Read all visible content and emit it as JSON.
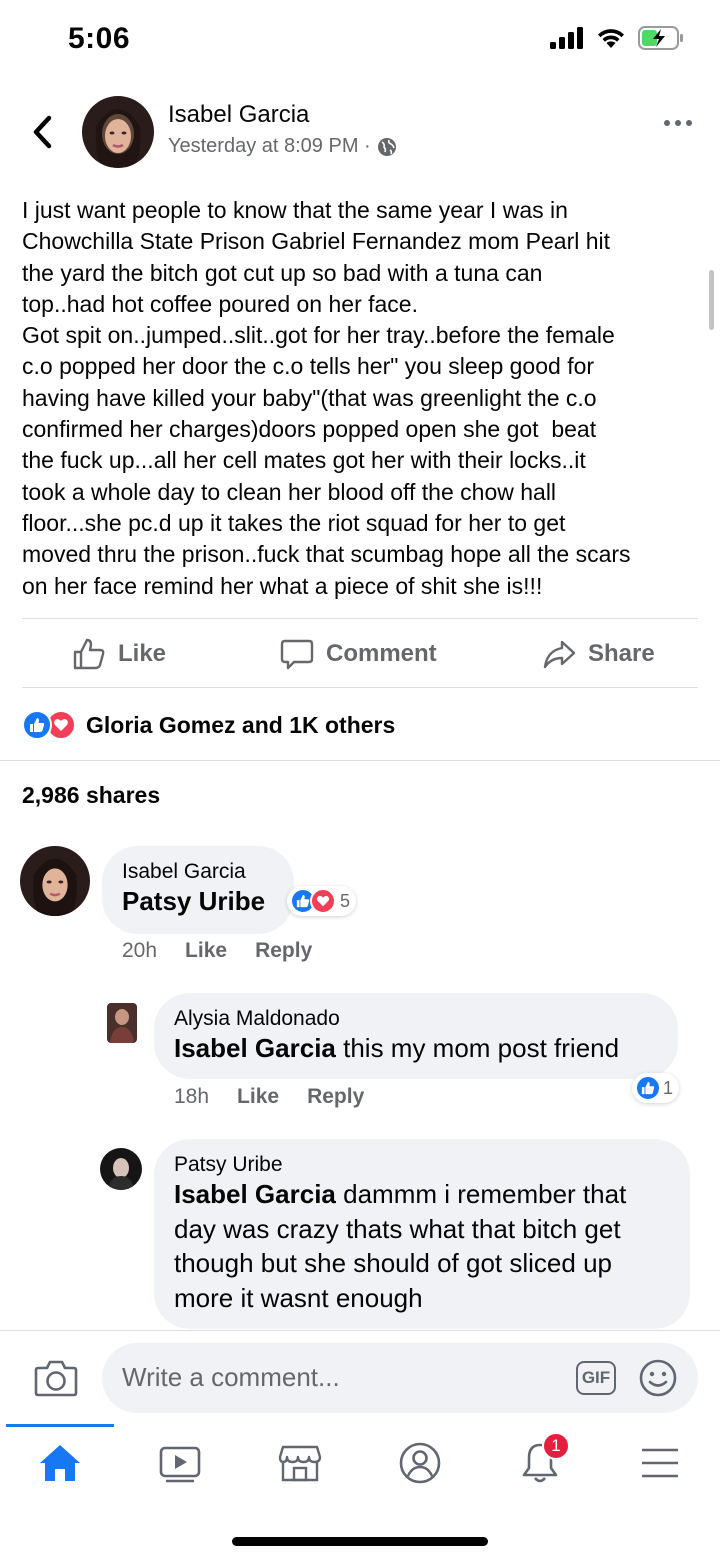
{
  "status_bar": {
    "time": "5:06"
  },
  "post": {
    "author": "Isabel Garcia",
    "timestamp": "Yesterday at 8:09 PM ·",
    "text": "I just want people to know that the same year I was in\nChowchilla State Prison Gabriel Fernandez mom Pearl hit\nthe yard the bitch got cut up so bad with a tuna can\ntop..had hot coffee poured on her face.\nGot spit on..jumped..slit..got for her tray..before the female\nc.o popped her door the c.o tells her\" you sleep good for\nhaving have killed your baby\"(that was greenlight the c.o\nconfirmed her charges)doors popped open she got  beat\nthe fuck up...all her cell mates got her with their locks..it\ntook a whole day to clean her blood off the chow hall\nfloor...she pc.d up it takes the riot squad for her to get\nmoved thru the prison..fuck that scumbag hope all the scars\non her face remind her what a piece of shit she is!!!"
  },
  "actions": {
    "like": "Like",
    "comment": "Comment",
    "share": "Share"
  },
  "reactions": {
    "summary": "Gloria Gomez and 1K others"
  },
  "shares": "2,986 shares",
  "comments": [
    {
      "author": "Isabel Garcia",
      "mention": "Patsy Uribe",
      "text": "",
      "time": "20h",
      "like": "Like",
      "reply": "Reply",
      "reaction_count": "5"
    },
    {
      "author": "Alysia Maldonado",
      "mention": "Isabel Garcia",
      "text": " this my mom post friend",
      "time": "18h",
      "like": "Like",
      "reply": "Reply",
      "reaction_count": "1"
    },
    {
      "author": "Patsy Uribe",
      "mention": "Isabel Garcia",
      "text": " dammm i remember that day was crazy thats what that bitch get though but she should of got sliced up more it wasnt enough"
    }
  ],
  "composer": {
    "placeholder": "Write a comment...",
    "gif": "GIF"
  },
  "tabs": {
    "notifications_badge": "1"
  },
  "colors": {
    "accent": "#1877f2",
    "love": "#f33e58",
    "badge": "#e41e3f",
    "bubble": "#f0f2f5"
  }
}
